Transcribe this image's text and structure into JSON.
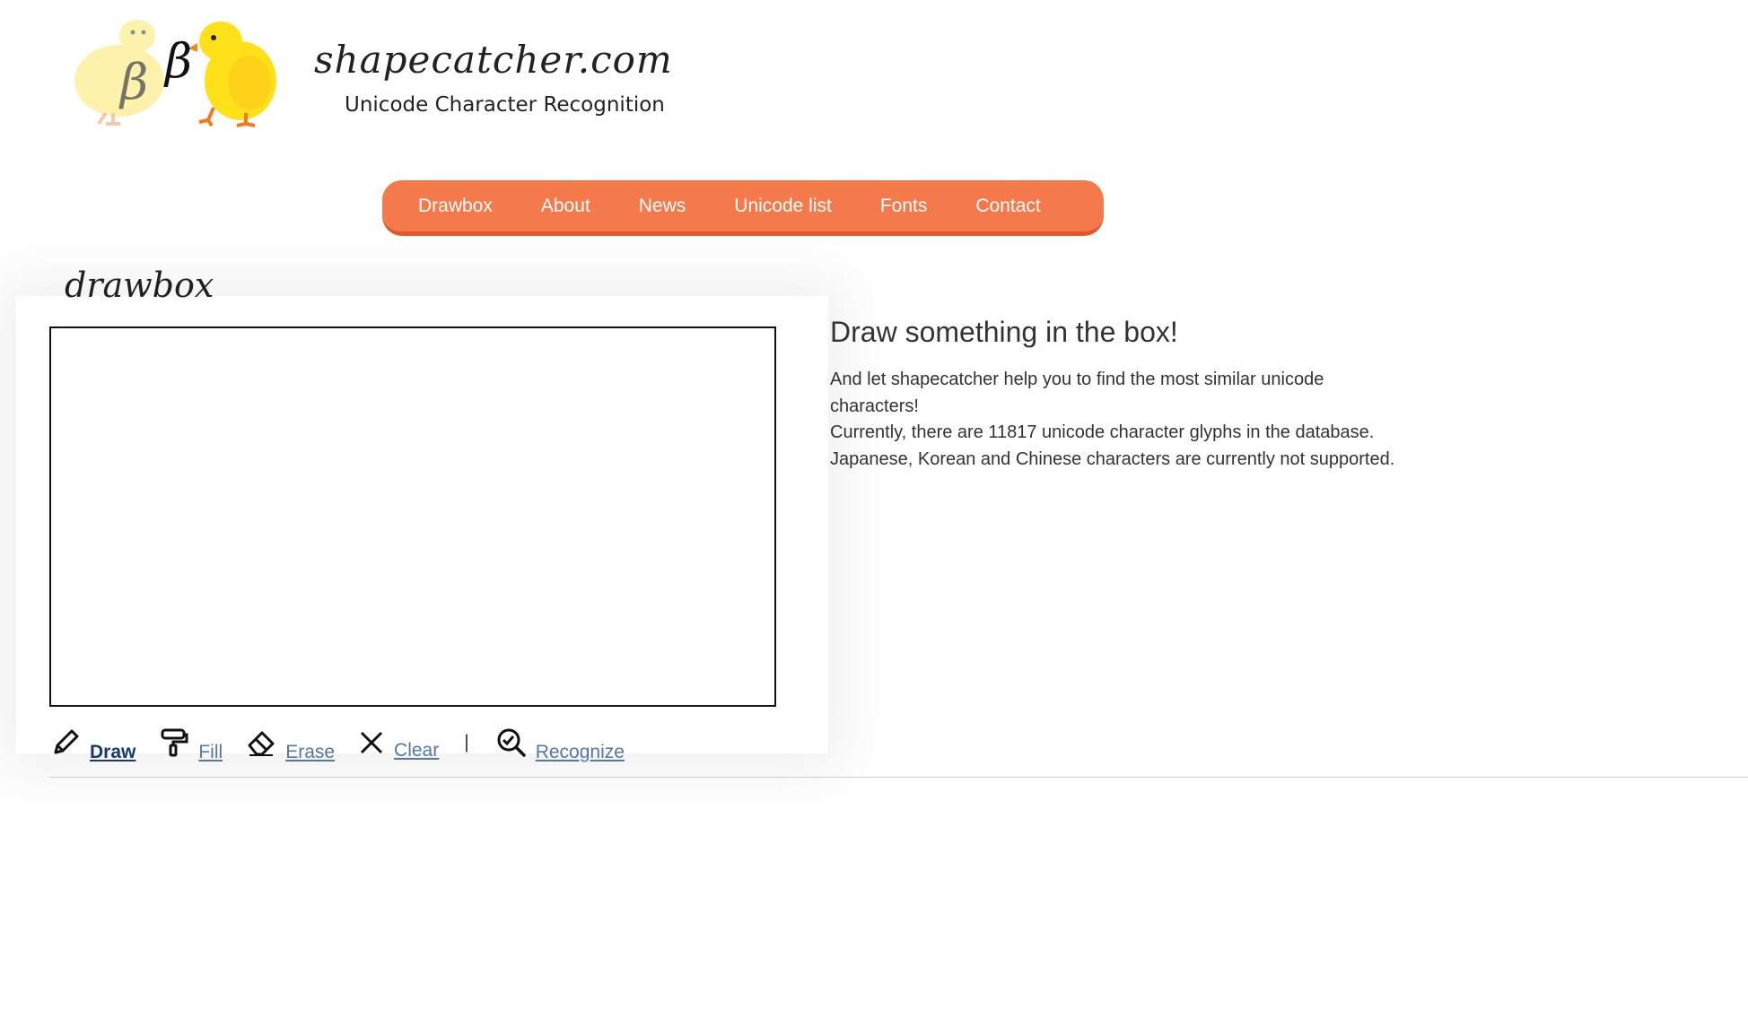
{
  "header": {
    "site_name": "shapecatcher.com",
    "subtitle": "Unicode Character Recognition",
    "logo_glyphs": [
      "β",
      "β"
    ]
  },
  "nav": {
    "items": [
      {
        "label": "Drawbox"
      },
      {
        "label": "About"
      },
      {
        "label": "News"
      },
      {
        "label": "Unicode list"
      },
      {
        "label": "Fonts"
      },
      {
        "label": "Contact"
      }
    ]
  },
  "drawbox": {
    "title": "drawbox"
  },
  "info": {
    "heading": "Draw something in the box!",
    "line1": "And let shapecatcher help you to find the most similar unicode characters!",
    "line2": "Currently, there are 11817 unicode character glyphs in the database.",
    "line3": "Japanese, Korean and Chinese characters are currently not supported."
  },
  "toolbar": {
    "draw": "Draw",
    "fill": "Fill",
    "erase": "Erase",
    "clear": "Clear",
    "separator": "|",
    "recognize": "Recognize",
    "active_tool": "Draw"
  },
  "colors": {
    "nav_bg": "#f47a4c",
    "nav_border": "#e2572a",
    "link": "#5577a0",
    "link_active": "#1a3a6a"
  }
}
